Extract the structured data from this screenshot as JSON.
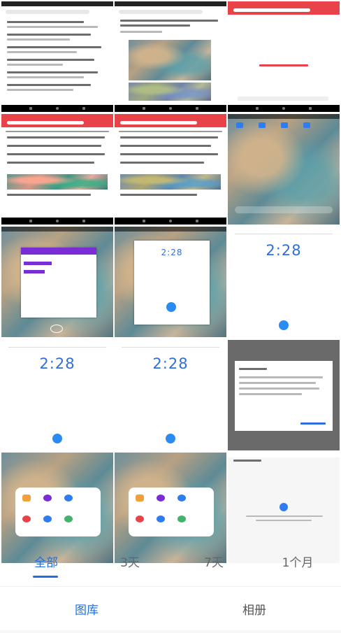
{
  "tabs": {
    "items": [
      "全部",
      "3天",
      "7天",
      "1个月"
    ],
    "active_index": 0
  },
  "bottom_nav": {
    "items": [
      "图库",
      "相册"
    ],
    "active_index": 0
  },
  "thumbnails": [
    {
      "kind": "news-feed"
    },
    {
      "kind": "news-article"
    },
    {
      "kind": "blank-loading"
    },
    {
      "kind": "news-list"
    },
    {
      "kind": "news-list"
    },
    {
      "kind": "home-screen"
    },
    {
      "kind": "recent-apps-dialog"
    },
    {
      "kind": "recent-apps-clock"
    },
    {
      "kind": "clock"
    },
    {
      "kind": "clock"
    },
    {
      "kind": "clock"
    },
    {
      "kind": "dialog"
    },
    {
      "kind": "app-drawer"
    },
    {
      "kind": "app-drawer"
    },
    {
      "kind": "empty-state"
    }
  ],
  "colors": {
    "accent": "#1f6fe0",
    "brand_red": "#e9434a",
    "clock_blue": "#2f6fdb"
  }
}
